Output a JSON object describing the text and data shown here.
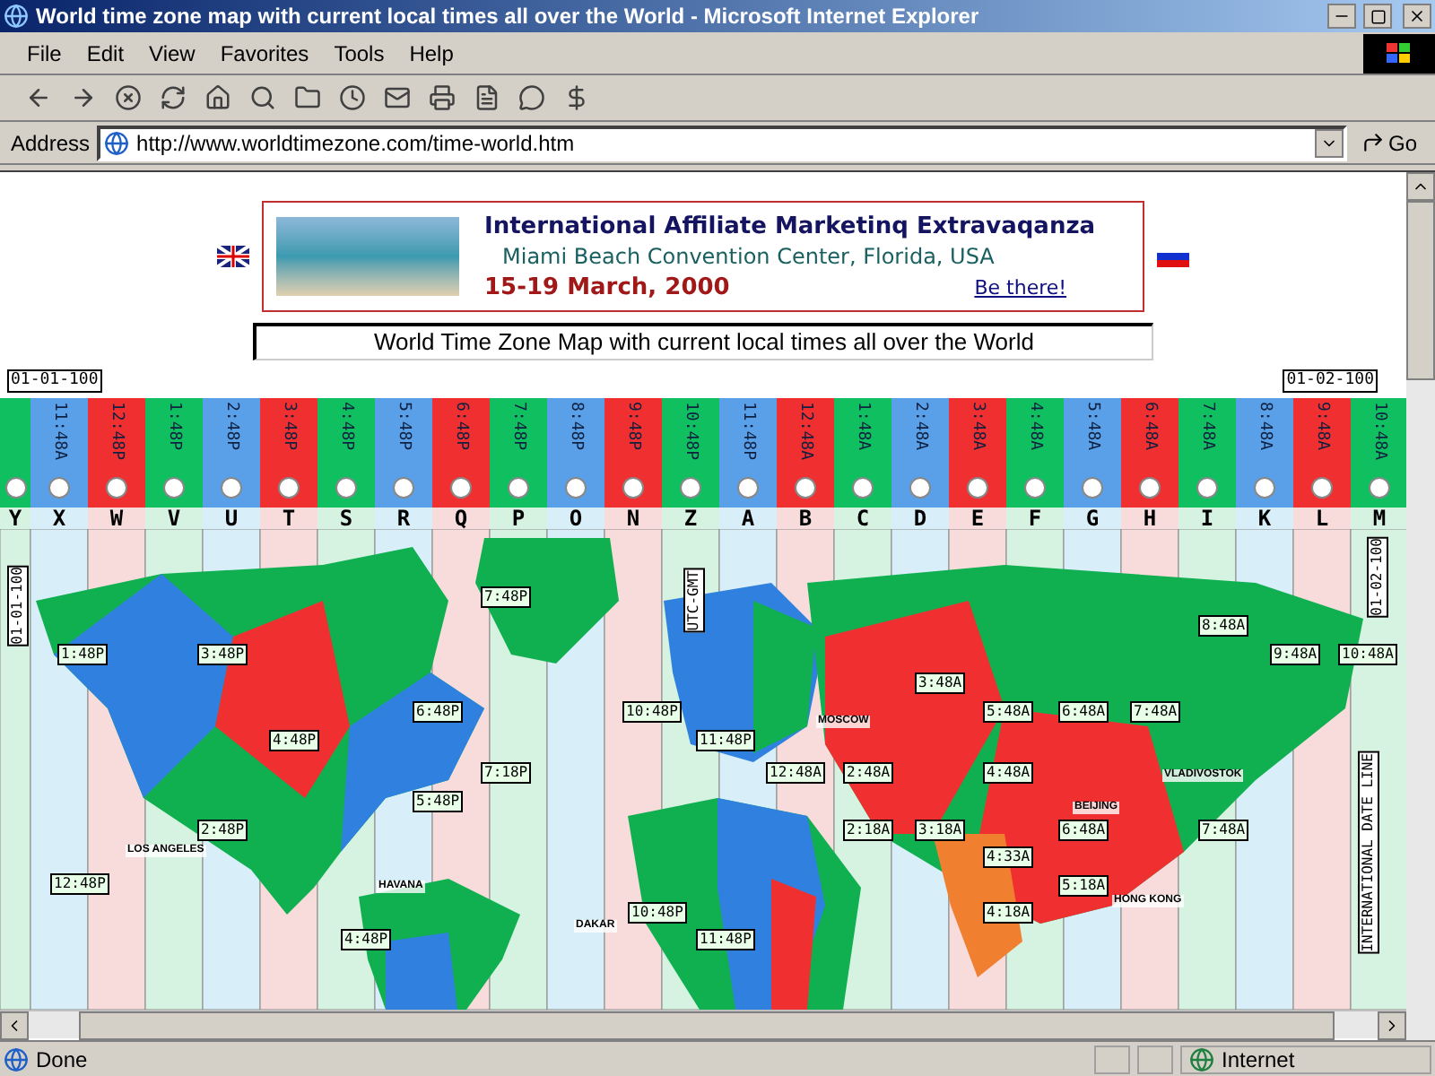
{
  "window": {
    "title": "World time zone map with current local times all over the World - Microsoft Internet Explorer"
  },
  "menu": [
    "File",
    "Edit",
    "View",
    "Favorites",
    "Tools",
    "Help"
  ],
  "address": {
    "label": "Address",
    "value": "http://www.worldtimezone.com/time-world.htm",
    "go": "Go"
  },
  "banner": {
    "title": "International Affiliate Marketinq Extravaqanza",
    "venue": "Miami Beach Convention Center, Florida, USA",
    "dates": "15-19 March, 2000",
    "link": "Be there!"
  },
  "page_title": "World Time Zone Map with current local times all over the World",
  "dates": {
    "left": "01-01-100",
    "right": "01-02-100"
  },
  "zones": [
    {
      "letter": "Y",
      "color": "#10c060"
    },
    {
      "letter": "X",
      "time": "11:48A",
      "color": "#5aa0e8"
    },
    {
      "letter": "W",
      "time": "12:48P",
      "color": "#f03030"
    },
    {
      "letter": "V",
      "time": "1:48P",
      "color": "#10c060"
    },
    {
      "letter": "U",
      "time": "2:48P",
      "color": "#5aa0e8"
    },
    {
      "letter": "T",
      "time": "3:48P",
      "color": "#f03030"
    },
    {
      "letter": "S",
      "time": "4:48P",
      "color": "#10c060"
    },
    {
      "letter": "R",
      "time": "5:48P",
      "color": "#5aa0e8"
    },
    {
      "letter": "Q",
      "time": "6:48P",
      "color": "#f03030"
    },
    {
      "letter": "P",
      "time": "7:48P",
      "color": "#10c060"
    },
    {
      "letter": "O",
      "time": "8:48P",
      "color": "#5aa0e8"
    },
    {
      "letter": "N",
      "time": "9:48P",
      "color": "#f03030"
    },
    {
      "letter": "Z",
      "time": "10:48P",
      "color": "#10c060"
    },
    {
      "letter": "A",
      "time": "11:48P",
      "color": "#5aa0e8"
    },
    {
      "letter": "B",
      "time": "12:48A",
      "color": "#f03030"
    },
    {
      "letter": "C",
      "time": "1:48A",
      "color": "#10c060"
    },
    {
      "letter": "D",
      "time": "2:48A",
      "color": "#5aa0e8"
    },
    {
      "letter": "E",
      "time": "3:48A",
      "color": "#f03030"
    },
    {
      "letter": "F",
      "time": "4:48A",
      "color": "#10c060"
    },
    {
      "letter": "G",
      "time": "5:48A",
      "color": "#5aa0e8"
    },
    {
      "letter": "H",
      "time": "6:48A",
      "color": "#f03030"
    },
    {
      "letter": "I",
      "time": "7:48A",
      "color": "#10c060"
    },
    {
      "letter": "K",
      "time": "8:48A",
      "color": "#5aa0e8"
    },
    {
      "letter": "L",
      "time": "9:48A",
      "color": "#f03030"
    },
    {
      "letter": "M",
      "time": "10:48A",
      "color": "#10c060"
    }
  ],
  "map_labels": [
    {
      "text": "01-01-100",
      "kind": "vertical"
    },
    {
      "text": "UTC-GMT",
      "kind": "vertical"
    },
    {
      "text": "01-02-100",
      "kind": "vertical"
    },
    {
      "text": "7:48P",
      "kind": "time"
    },
    {
      "text": "8:48A",
      "kind": "time"
    },
    {
      "text": "1:48P",
      "kind": "time"
    },
    {
      "text": "3:48P",
      "kind": "time"
    },
    {
      "text": "9:48A",
      "kind": "time"
    },
    {
      "text": "10:48A",
      "kind": "time"
    },
    {
      "text": "3:48A",
      "kind": "time"
    },
    {
      "text": "6:48P",
      "kind": "time"
    },
    {
      "text": "10:48P",
      "kind": "time"
    },
    {
      "text": "5:48A",
      "kind": "time"
    },
    {
      "text": "6:48A",
      "kind": "time"
    },
    {
      "text": "7:48A",
      "kind": "time"
    },
    {
      "text": "MOSCOW",
      "kind": "city"
    },
    {
      "text": "4:48P",
      "kind": "time"
    },
    {
      "text": "11:48P",
      "kind": "time"
    },
    {
      "text": "7:18P",
      "kind": "time"
    },
    {
      "text": "12:48A",
      "kind": "time"
    },
    {
      "text": "2:48A",
      "kind": "time"
    },
    {
      "text": "4:48A",
      "kind": "time"
    },
    {
      "text": "VLADIVOSTOK",
      "kind": "city"
    },
    {
      "text": "5:48P",
      "kind": "time"
    },
    {
      "text": "BEIJING",
      "kind": "city"
    },
    {
      "text": "2:48P",
      "kind": "time"
    },
    {
      "text": "LOS ANGELES",
      "kind": "city"
    },
    {
      "text": "2:18A",
      "kind": "time"
    },
    {
      "text": "3:18A",
      "kind": "time"
    },
    {
      "text": "6:48A",
      "kind": "time"
    },
    {
      "text": "7:48A",
      "kind": "time"
    },
    {
      "text": "4:33A",
      "kind": "time"
    },
    {
      "text": "12:48P",
      "kind": "time"
    },
    {
      "text": "HAVANA",
      "kind": "city"
    },
    {
      "text": "5:18A",
      "kind": "time"
    },
    {
      "text": "HONG KONG",
      "kind": "city"
    },
    {
      "text": "10:48P",
      "kind": "time"
    },
    {
      "text": "4:18A",
      "kind": "time"
    },
    {
      "text": "DAKAR",
      "kind": "city"
    },
    {
      "text": "4:48P",
      "kind": "time"
    },
    {
      "text": "11:48P",
      "kind": "time"
    },
    {
      "text": "INTERNATIONAL DATE LINE",
      "kind": "vertical"
    }
  ],
  "status_bar": {
    "text": "Done",
    "zone": "Internet"
  }
}
